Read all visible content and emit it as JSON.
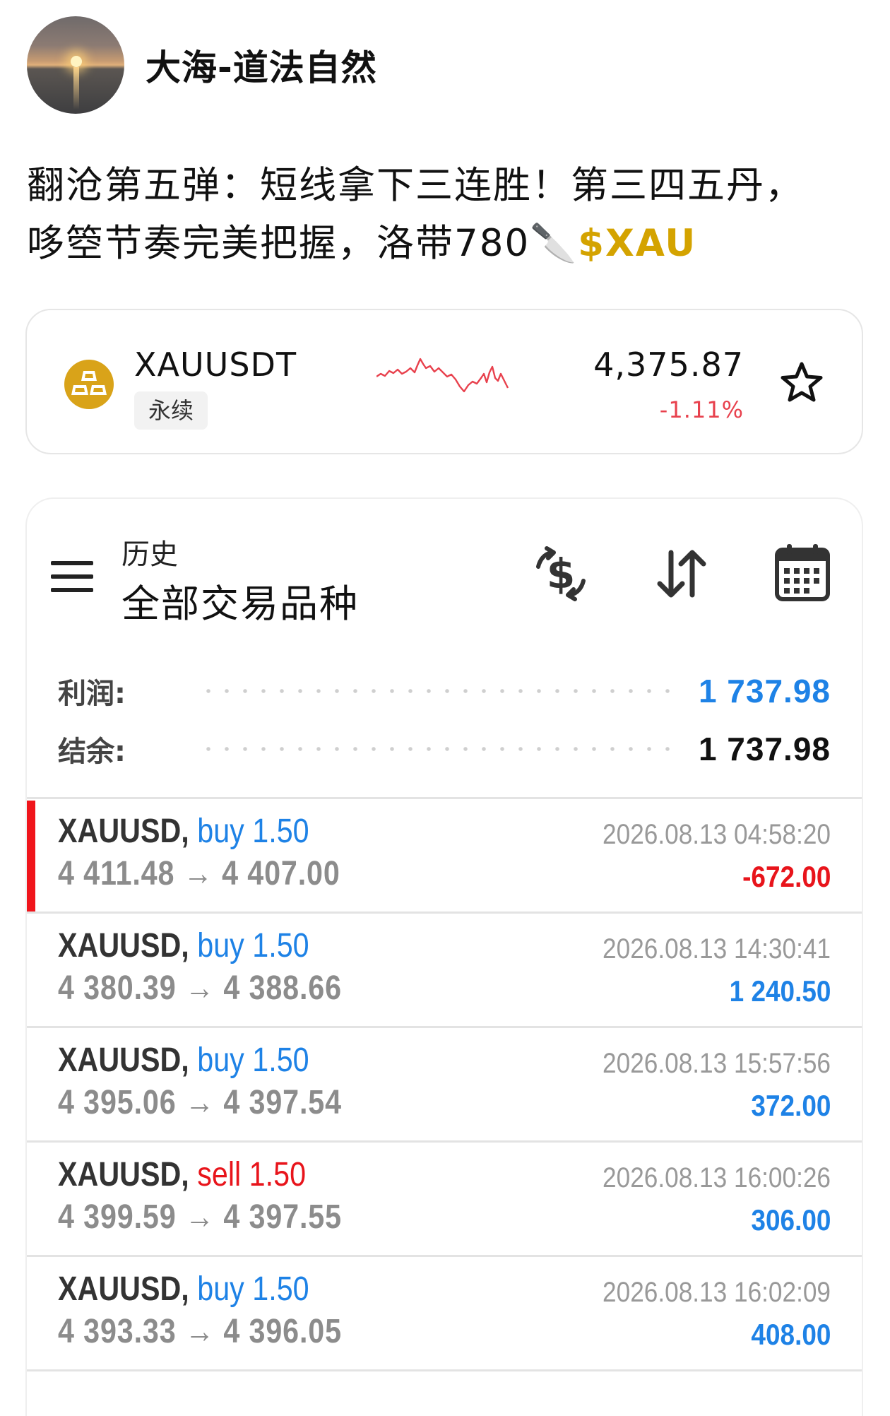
{
  "post": {
    "author": "大海-道法自然",
    "text_line1": "翻沧第五弹：短线拿下三连胜！第三四五丹，",
    "text_line2_prefix": "哆箜节奏完美把握，洛带780",
    "text_emoji": "🔪",
    "ticker_tag": "$XAU",
    "ticker_color": "#d4a300"
  },
  "ticker_card": {
    "symbol": "XAUUSDT",
    "badge": "永续",
    "price": "4,375.87",
    "change": "-1.11%",
    "icon": "gold-bars-icon",
    "sparkline_color": "#e8414d",
    "action_icon": "star-icon"
  },
  "history": {
    "subtitle": "历史",
    "title": "全部交易品种",
    "menu_icon": "hamburger-menu-icon",
    "tools": [
      "currency-exchange-icon",
      "sort-arrows-icon",
      "calendar-icon"
    ],
    "profit_label": "利润:",
    "profit_value": "1 737.98",
    "balance_label": "结余:",
    "balance_value": "1 737.98",
    "colors": {
      "positive": "#1e82e6",
      "negative": "#e8141b",
      "buy": "#1e82e6",
      "sell": "#e8141b"
    },
    "trades": [
      {
        "symbol": "XAUUSD,",
        "side": "buy",
        "volume": "1.50",
        "open": "4 411.48",
        "arrow": "→",
        "close": "4 407.00",
        "time": "2026.08.13 04:58:20",
        "pl": "-672.00",
        "selected": true
      },
      {
        "symbol": "XAUUSD,",
        "side": "buy",
        "volume": "1.50",
        "open": "4 380.39",
        "arrow": "→",
        "close": "4 388.66",
        "time": "2026.08.13 14:30:41",
        "pl": "1 240.50",
        "selected": false
      },
      {
        "symbol": "XAUUSD,",
        "side": "buy",
        "volume": "1.50",
        "open": "4 395.06",
        "arrow": "→",
        "close": "4 397.54",
        "time": "2026.08.13 15:57:56",
        "pl": "372.00",
        "selected": false
      },
      {
        "symbol": "XAUUSD,",
        "side": "sell",
        "volume": "1.50",
        "open": "4 399.59",
        "arrow": "→",
        "close": "4 397.55",
        "time": "2026.08.13 16:00:26",
        "pl": "306.00",
        "selected": false
      },
      {
        "symbol": "XAUUSD,",
        "side": "buy",
        "volume": "1.50",
        "open": "4 393.33",
        "arrow": "→",
        "close": "4 396.05",
        "time": "2026.08.13 16:02:09",
        "pl": "408.00",
        "selected": false
      }
    ]
  }
}
